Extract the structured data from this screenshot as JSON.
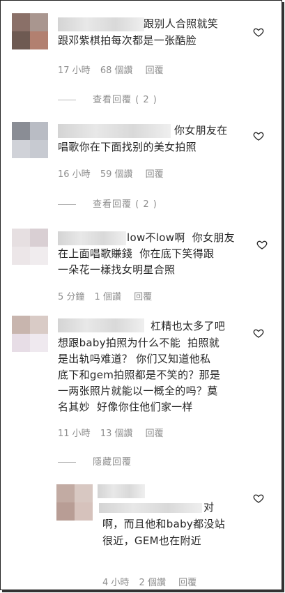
{
  "comments": [
    {
      "text_lines": [
        "跟别人合照就笑",
        "跟邓紫棋拍每次都是一张酷脸"
      ],
      "time": "17 小時",
      "likes": "68 個讚",
      "reply": "回覆",
      "view_replies": "查看回覆 ( 2 )"
    },
    {
      "text_lines": [
        "你女朋友在",
        "唱歌你在下面找别的美女拍照"
      ],
      "time": "16 小時",
      "likes": "59 個讚",
      "reply": "回覆",
      "view_replies": "查看回覆 ( 2 )"
    },
    {
      "text_lines": [
        "low不low啊  你女朋友",
        "在上面唱歌賺錢  你在底下笑得跟",
        "一朵花一樣找女明星合照"
      ],
      "time": "5 分鐘",
      "likes": "1 個讚",
      "reply": "回覆"
    },
    {
      "text_lines": [
        "杠精也太多了吧",
        "想跟baby拍照为什么不能  拍照就",
        "是出轨吗难道？ 你们又知道他私",
        "底下和gem拍照都是不笑的？那是",
        "一两张照片就能以一概全的吗？莫",
        "名其妙  好像你住他们家一样"
      ],
      "time": "11 小時",
      "likes": "13 個讚",
      "reply": "回覆",
      "hide_replies": "隱藏回覆"
    },
    {
      "text_lines": [
        "对",
        "啊，而且他和baby都没站",
        "很近，GEM也在附近"
      ],
      "time": "4 小時",
      "likes": "2 個讚",
      "reply": "回覆"
    }
  ],
  "icons": {
    "like": "heart-outline-icon"
  },
  "colors": {
    "text": "#262626",
    "meta": "#8e8e8e"
  }
}
